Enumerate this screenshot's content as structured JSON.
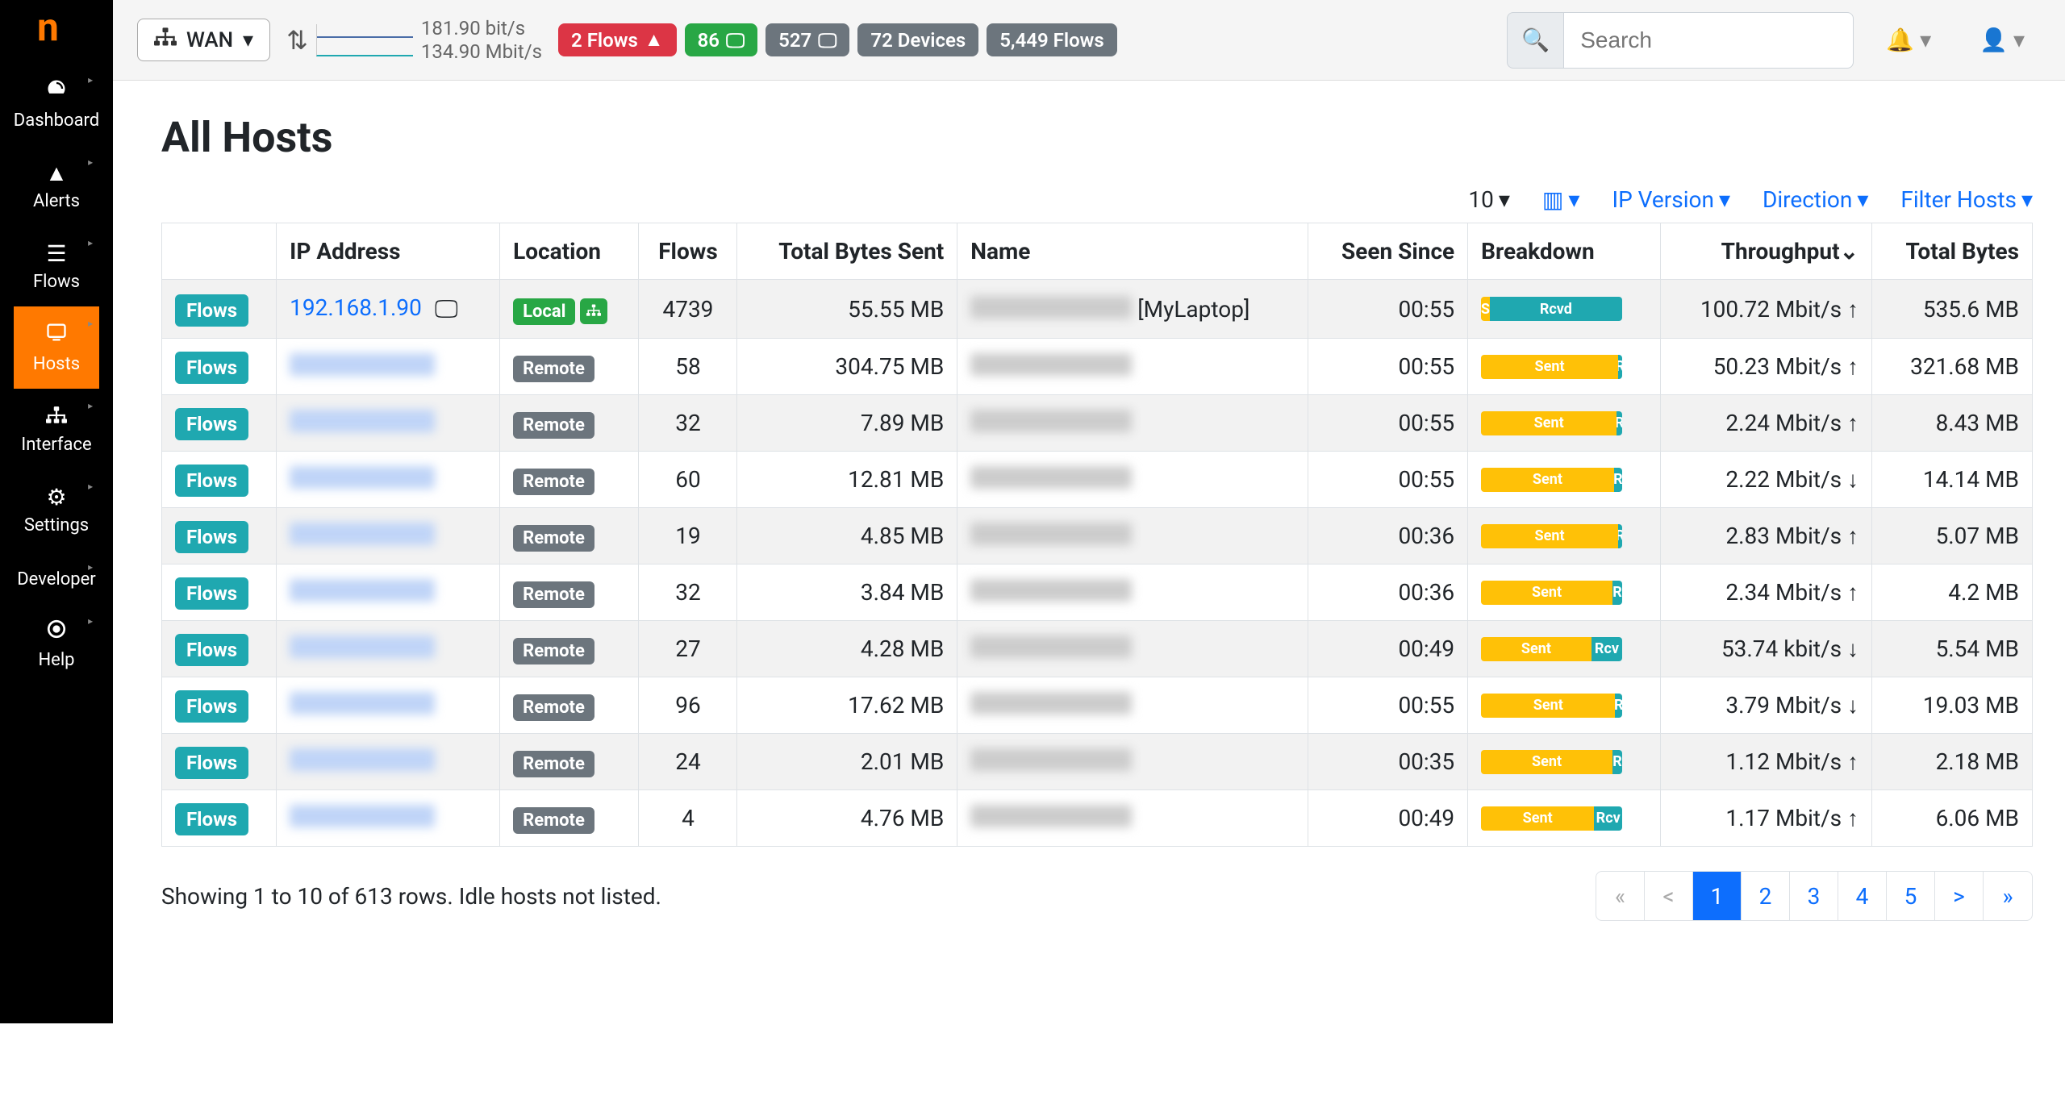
{
  "sidebar": {
    "items": [
      {
        "label": "Dashboard"
      },
      {
        "label": "Alerts"
      },
      {
        "label": "Flows"
      },
      {
        "label": "Hosts"
      },
      {
        "label": "Interface"
      },
      {
        "label": "Settings"
      },
      {
        "label": "Developer"
      },
      {
        "label": "Help"
      }
    ]
  },
  "topbar": {
    "interface": "WAN",
    "up_rate": "181.90 bit/s",
    "down_rate": "134.90 Mbit/s",
    "badges": {
      "flows_alert": "2 Flows",
      "green_count": "86",
      "gray_count": "527",
      "devices": "72 Devices",
      "total_flows": "5,449 Flows"
    },
    "search_placeholder": "Search"
  },
  "page_title": "All Hosts",
  "controls": {
    "page_size": "10",
    "ip_version": "IP Version",
    "direction": "Direction",
    "filter_hosts": "Filter Hosts"
  },
  "columns": {
    "ip": "IP Address",
    "location": "Location",
    "flows": "Flows",
    "bytes_sent": "Total Bytes Sent",
    "name": "Name",
    "seen": "Seen Since",
    "breakdown": "Breakdown",
    "throughput": "Throughput",
    "total_bytes": "Total Bytes"
  },
  "flows_label": "Flows",
  "rows": [
    {
      "ip": "192.168.1.90",
      "mask_ip": false,
      "os_icons": true,
      "location": "Local",
      "local_extra": true,
      "flows": "4739",
      "bytes_sent": "55.55 MB",
      "name": "[MyLaptop]",
      "name_blur": true,
      "seen": "00:55",
      "sent_pct": 6,
      "rcvd_pct": 94,
      "sent_label": "S",
      "rcvd_label": "Rcvd",
      "throughput": "100.72 Mbit/s",
      "arrow": "↑",
      "total": "535.6 MB"
    },
    {
      "ip": "",
      "mask_ip": true,
      "location": "Remote",
      "flows": "58",
      "bytes_sent": "304.75 MB",
      "name": "",
      "name_blur": true,
      "seen": "00:55",
      "sent_pct": 97,
      "rcvd_pct": 3,
      "sent_label": "Sent",
      "rcvd_label": "R",
      "throughput": "50.23 Mbit/s",
      "arrow": "↑",
      "total": "321.68 MB"
    },
    {
      "ip": "",
      "mask_ip": true,
      "location": "Remote",
      "flows": "32",
      "bytes_sent": "7.89 MB",
      "name": "",
      "name_blur": true,
      "seen": "00:55",
      "sent_pct": 96,
      "rcvd_pct": 4,
      "sent_label": "Sent",
      "rcvd_label": "R",
      "throughput": "2.24 Mbit/s",
      "arrow": "↑",
      "total": "8.43 MB"
    },
    {
      "ip": "",
      "mask_ip": true,
      "location": "Remote",
      "flows": "60",
      "bytes_sent": "12.81 MB",
      "name": "",
      "name_blur": true,
      "seen": "00:55",
      "sent_pct": 94,
      "rcvd_pct": 6,
      "sent_label": "Sent",
      "rcvd_label": "R",
      "throughput": "2.22 Mbit/s",
      "arrow": "↓",
      "total": "14.14 MB"
    },
    {
      "ip": "",
      "mask_ip": true,
      "location": "Remote",
      "flows": "19",
      "bytes_sent": "4.85 MB",
      "name": "",
      "name_blur": true,
      "seen": "00:36",
      "sent_pct": 97,
      "rcvd_pct": 3,
      "sent_label": "Sent",
      "rcvd_label": "R",
      "throughput": "2.83 Mbit/s",
      "arrow": "↑",
      "total": "5.07 MB"
    },
    {
      "ip": "",
      "mask_ip": true,
      "location": "Remote",
      "flows": "32",
      "bytes_sent": "3.84 MB",
      "name": "",
      "name_blur": true,
      "seen": "00:36",
      "sent_pct": 93,
      "rcvd_pct": 7,
      "sent_label": "Sent",
      "rcvd_label": "R",
      "throughput": "2.34 Mbit/s",
      "arrow": "↑",
      "total": "4.2 MB"
    },
    {
      "ip": "",
      "mask_ip": true,
      "location": "Remote",
      "flows": "27",
      "bytes_sent": "4.28 MB",
      "name": "",
      "name_blur": true,
      "seen": "00:49",
      "sent_pct": 78,
      "rcvd_pct": 22,
      "sent_label": "Sent",
      "rcvd_label": "Rcv",
      "throughput": "53.74 kbit/s",
      "arrow": "↓",
      "total": "5.54 MB"
    },
    {
      "ip": "",
      "mask_ip": true,
      "location": "Remote",
      "flows": "96",
      "bytes_sent": "17.62 MB",
      "name": "",
      "name_blur": true,
      "seen": "00:55",
      "sent_pct": 95,
      "rcvd_pct": 5,
      "sent_label": "Sent",
      "rcvd_label": "R",
      "throughput": "3.79 Mbit/s",
      "arrow": "↓",
      "total": "19.03 MB"
    },
    {
      "ip": "",
      "mask_ip": true,
      "location": "Remote",
      "flows": "24",
      "bytes_sent": "2.01 MB",
      "name": "",
      "name_blur": true,
      "seen": "00:35",
      "sent_pct": 93,
      "rcvd_pct": 7,
      "sent_label": "Sent",
      "rcvd_label": "R",
      "throughput": "1.12 Mbit/s",
      "arrow": "↑",
      "total": "2.18 MB"
    },
    {
      "ip": "",
      "mask_ip": true,
      "location": "Remote",
      "flows": "4",
      "bytes_sent": "4.76 MB",
      "name": "",
      "name_blur": true,
      "seen": "00:49",
      "sent_pct": 80,
      "rcvd_pct": 20,
      "sent_label": "Sent",
      "rcvd_label": "Rcv",
      "throughput": "1.17 Mbit/s",
      "arrow": "↑",
      "total": "6.06 MB"
    }
  ],
  "footer": {
    "showing": "Showing 1 to 10 of 613 rows. Idle hosts not listed.",
    "pages": [
      "«",
      "<",
      "1",
      "2",
      "3",
      "4",
      "5",
      ">",
      "»"
    ],
    "active_page": "1"
  }
}
